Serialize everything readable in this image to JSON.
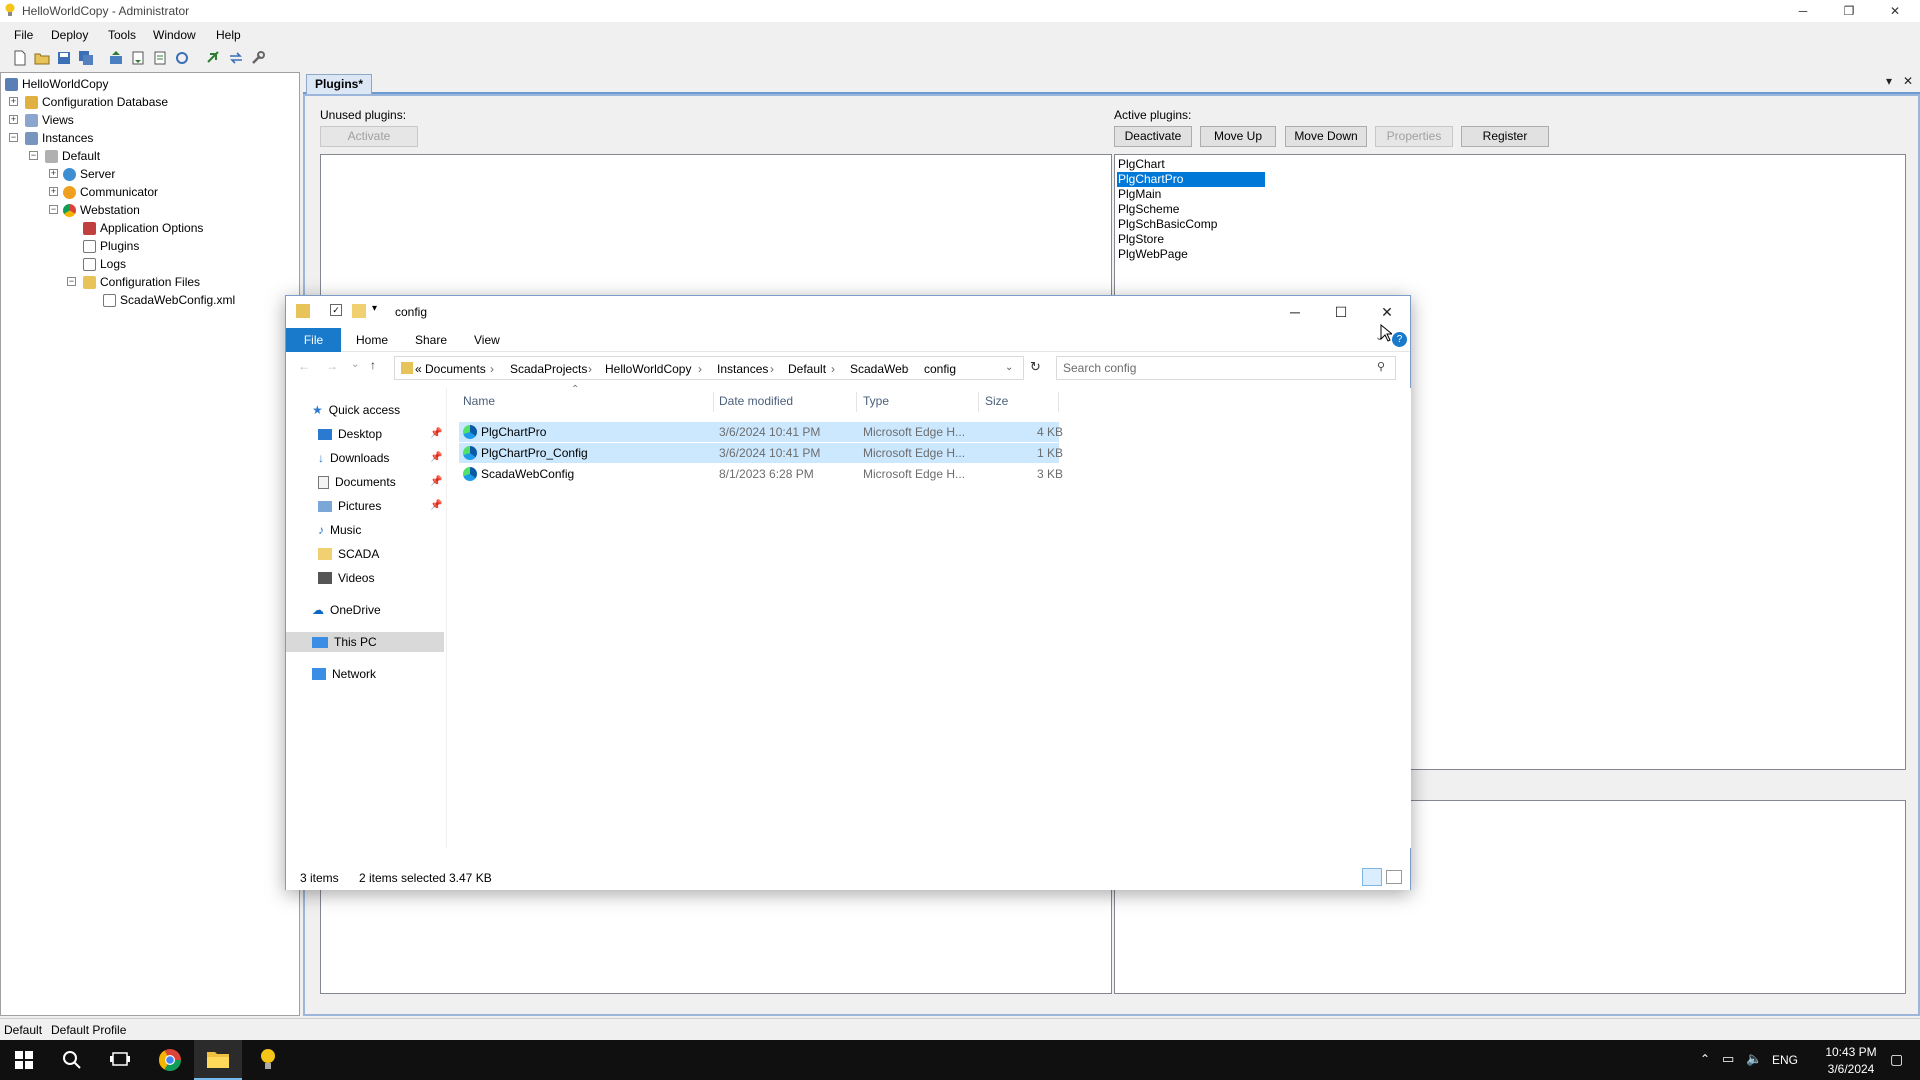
{
  "app": {
    "title": "HelloWorldCopy - Administrator",
    "menu": [
      "File",
      "Deploy",
      "Tools",
      "Window",
      "Help"
    ]
  },
  "tree": {
    "root": "HelloWorldCopy",
    "items": [
      {
        "label": "Configuration Database"
      },
      {
        "label": "Views"
      },
      {
        "label": "Instances"
      },
      {
        "label": "Default"
      },
      {
        "label": "Server"
      },
      {
        "label": "Communicator"
      },
      {
        "label": "Webstation"
      },
      {
        "label": "Application Options"
      },
      {
        "label": "Plugins"
      },
      {
        "label": "Logs"
      },
      {
        "label": "Configuration Files"
      },
      {
        "label": "ScadaWebConfig.xml"
      }
    ]
  },
  "tab": {
    "label": "Plugins*"
  },
  "plugins": {
    "unused_label": "Unused plugins:",
    "active_label": "Active plugins:",
    "activate": "Activate",
    "deactivate": "Deactivate",
    "move_up": "Move Up",
    "move_down": "Move Down",
    "properties": "Properties",
    "register": "Register",
    "active": [
      "PlgChart",
      "PlgChartPro",
      "PlgMain",
      "PlgScheme",
      "PlgSchBasicComp",
      "PlgStore",
      "PlgWebPage"
    ],
    "selected_index": 1
  },
  "statusbar": {
    "instance": "Default",
    "profile": "Default Profile"
  },
  "explorer": {
    "title": "config",
    "ribbon": {
      "file": "File",
      "home": "Home",
      "share": "Share",
      "view": "View"
    },
    "breadcrumb": [
      "«",
      "Documents",
      "ScadaProjects",
      "HelloWorldCopy",
      "Instances",
      "Default",
      "ScadaWeb",
      "config"
    ],
    "search_placeholder": "Search config",
    "sidebar": [
      {
        "label": "Quick access"
      },
      {
        "label": "Desktop"
      },
      {
        "label": "Downloads"
      },
      {
        "label": "Documents"
      },
      {
        "label": "Pictures"
      },
      {
        "label": "Music"
      },
      {
        "label": "SCADA"
      },
      {
        "label": "Videos"
      },
      {
        "label": "OneDrive"
      },
      {
        "label": "This PC"
      },
      {
        "label": "Network"
      }
    ],
    "columns": {
      "name": "Name",
      "date": "Date modified",
      "type": "Type",
      "size": "Size"
    },
    "files": [
      {
        "name": "PlgChartPro",
        "date": "3/6/2024 10:41 PM",
        "type": "Microsoft Edge H...",
        "size": "4 KB",
        "selected": true
      },
      {
        "name": "PlgChartPro_Config",
        "date": "3/6/2024 10:41 PM",
        "type": "Microsoft Edge H...",
        "size": "1 KB",
        "selected": true
      },
      {
        "name": "ScadaWebConfig",
        "date": "8/1/2023 6:28 PM",
        "type": "Microsoft Edge H...",
        "size": "3 KB",
        "selected": false
      }
    ],
    "status": {
      "count": "3 items",
      "selected": "2 items selected",
      "size": "3.47 KB"
    }
  },
  "taskbar": {
    "lang": "ENG",
    "time": "10:43 PM",
    "date": "3/6/2024"
  },
  "colors": {
    "selection": "#0078d7",
    "explorer_selection": "#cce8ff",
    "ribbon_file": "#1979ca"
  }
}
